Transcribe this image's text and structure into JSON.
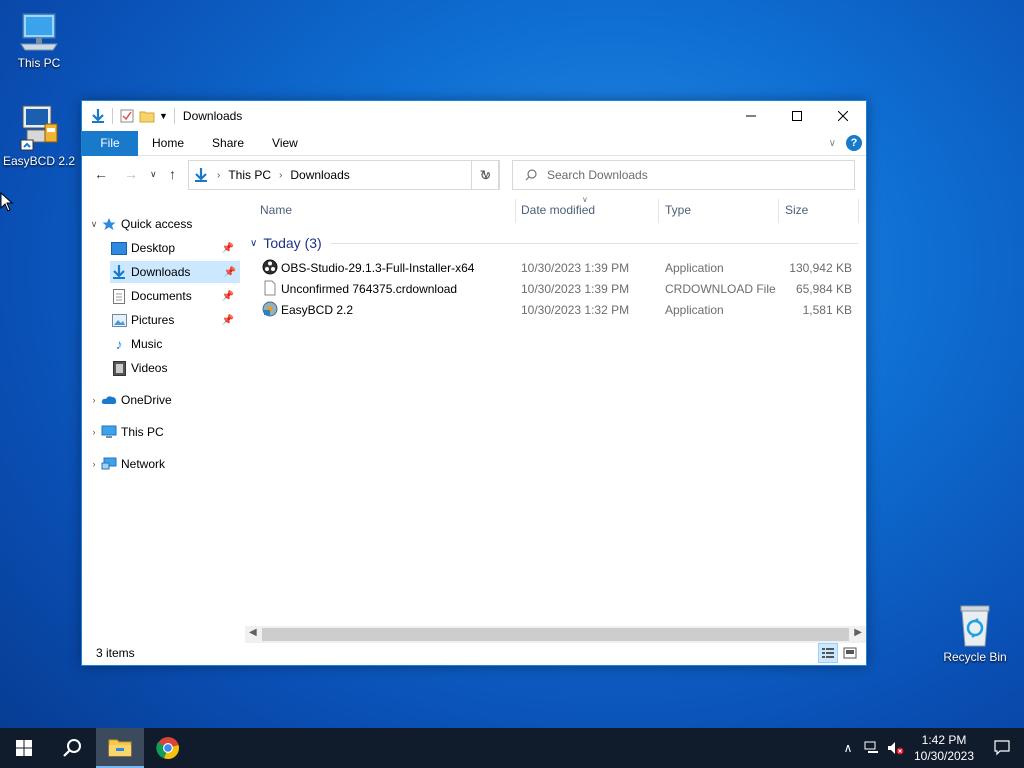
{
  "desktop": {
    "icons": [
      {
        "label": "This PC"
      },
      {
        "label": "EasyBCD 2.2"
      },
      {
        "label": "Recycle Bin"
      }
    ]
  },
  "window": {
    "title": "Downloads",
    "ribbon_tabs": [
      "File",
      "Home",
      "Share",
      "View"
    ],
    "address": {
      "crumbs": [
        "This PC",
        "Downloads"
      ]
    },
    "search": {
      "placeholder": "Search Downloads"
    },
    "nav": {
      "quick_access": "Quick access",
      "items": [
        "Desktop",
        "Downloads",
        "Documents",
        "Pictures",
        "Music",
        "Videos"
      ],
      "onedrive": "OneDrive",
      "thispc": "This PC",
      "network": "Network"
    },
    "columns": {
      "name": "Name",
      "date": "Date modified",
      "type": "Type",
      "size": "Size"
    },
    "group": "Today (3)",
    "files": [
      {
        "name": "OBS-Studio-29.1.3-Full-Installer-x64",
        "date": "10/30/2023 1:39 PM",
        "type": "Application",
        "size": "130,942 KB"
      },
      {
        "name": "Unconfirmed 764375.crdownload",
        "date": "10/30/2023 1:39 PM",
        "type": "CRDOWNLOAD File",
        "size": "65,984 KB"
      },
      {
        "name": "EasyBCD 2.2",
        "date": "10/30/2023 1:32 PM",
        "type": "Application",
        "size": "1,581 KB"
      }
    ],
    "status": "3 items"
  },
  "taskbar": {
    "time": "1:42 PM",
    "date": "10/30/2023"
  },
  "colors": {
    "accent": "#1979ca",
    "selection": "#cce8ff",
    "taskbar": "#101c2c"
  }
}
